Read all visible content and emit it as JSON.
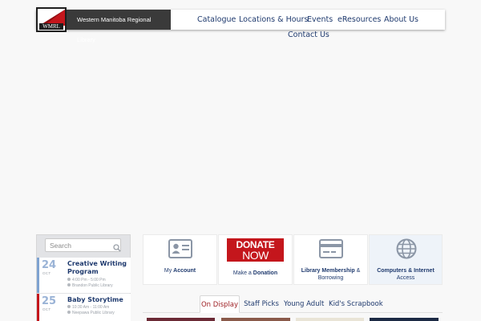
{
  "brand": {
    "name": "Western Manitoba Regional Library",
    "logo_text": "WMRL"
  },
  "nav": {
    "items": [
      {
        "label": "Catalogue"
      },
      {
        "label": "Locations & Hours"
      },
      {
        "label": "Events"
      },
      {
        "label": "eResources"
      },
      {
        "label": "About Us"
      },
      {
        "label": "Contact Us"
      }
    ]
  },
  "search": {
    "placeholder": "Search"
  },
  "events": [
    {
      "day": "24",
      "month": "OCT",
      "title": "Creative Writing Program",
      "time": "4:00 Pm - 5:00 Pm",
      "location": "Brandon Public Library",
      "accent": "#7fa3d1"
    },
    {
      "day": "25",
      "month": "OCT",
      "title": "Baby Storytime",
      "time": "10:30 Am - 11:00 Am",
      "location": "Neepawa Public Library",
      "accent": "#c4161c"
    }
  ],
  "tiles": [
    {
      "label_pre": "My ",
      "label_bold": "Account",
      "label_post": "",
      "icon": "id-card-icon"
    },
    {
      "label_pre": "Make a ",
      "label_bold": "Donation",
      "label_post": "",
      "icon": "donate-now-badge",
      "badge_line1": "DONATE",
      "badge_line2": "NOW"
    },
    {
      "label_pre": "",
      "label_bold": "Library Membership",
      "label_post": " & Borrowing",
      "icon": "library-card-icon"
    },
    {
      "label_pre": "",
      "label_bold": "Computers & Internet",
      "label_post": " Access",
      "icon": "globe-icon"
    }
  ],
  "tabs": [
    {
      "label": "On Display",
      "active": true
    },
    {
      "label": "Staff Picks",
      "active": false
    },
    {
      "label": "Young Adult",
      "active": false
    },
    {
      "label": "Kid's Scrapbook",
      "active": false
    }
  ],
  "colors": {
    "accent_red": "#c4161c",
    "link_blue": "#1f3a6e",
    "header_dark": "#3a3a3a"
  }
}
